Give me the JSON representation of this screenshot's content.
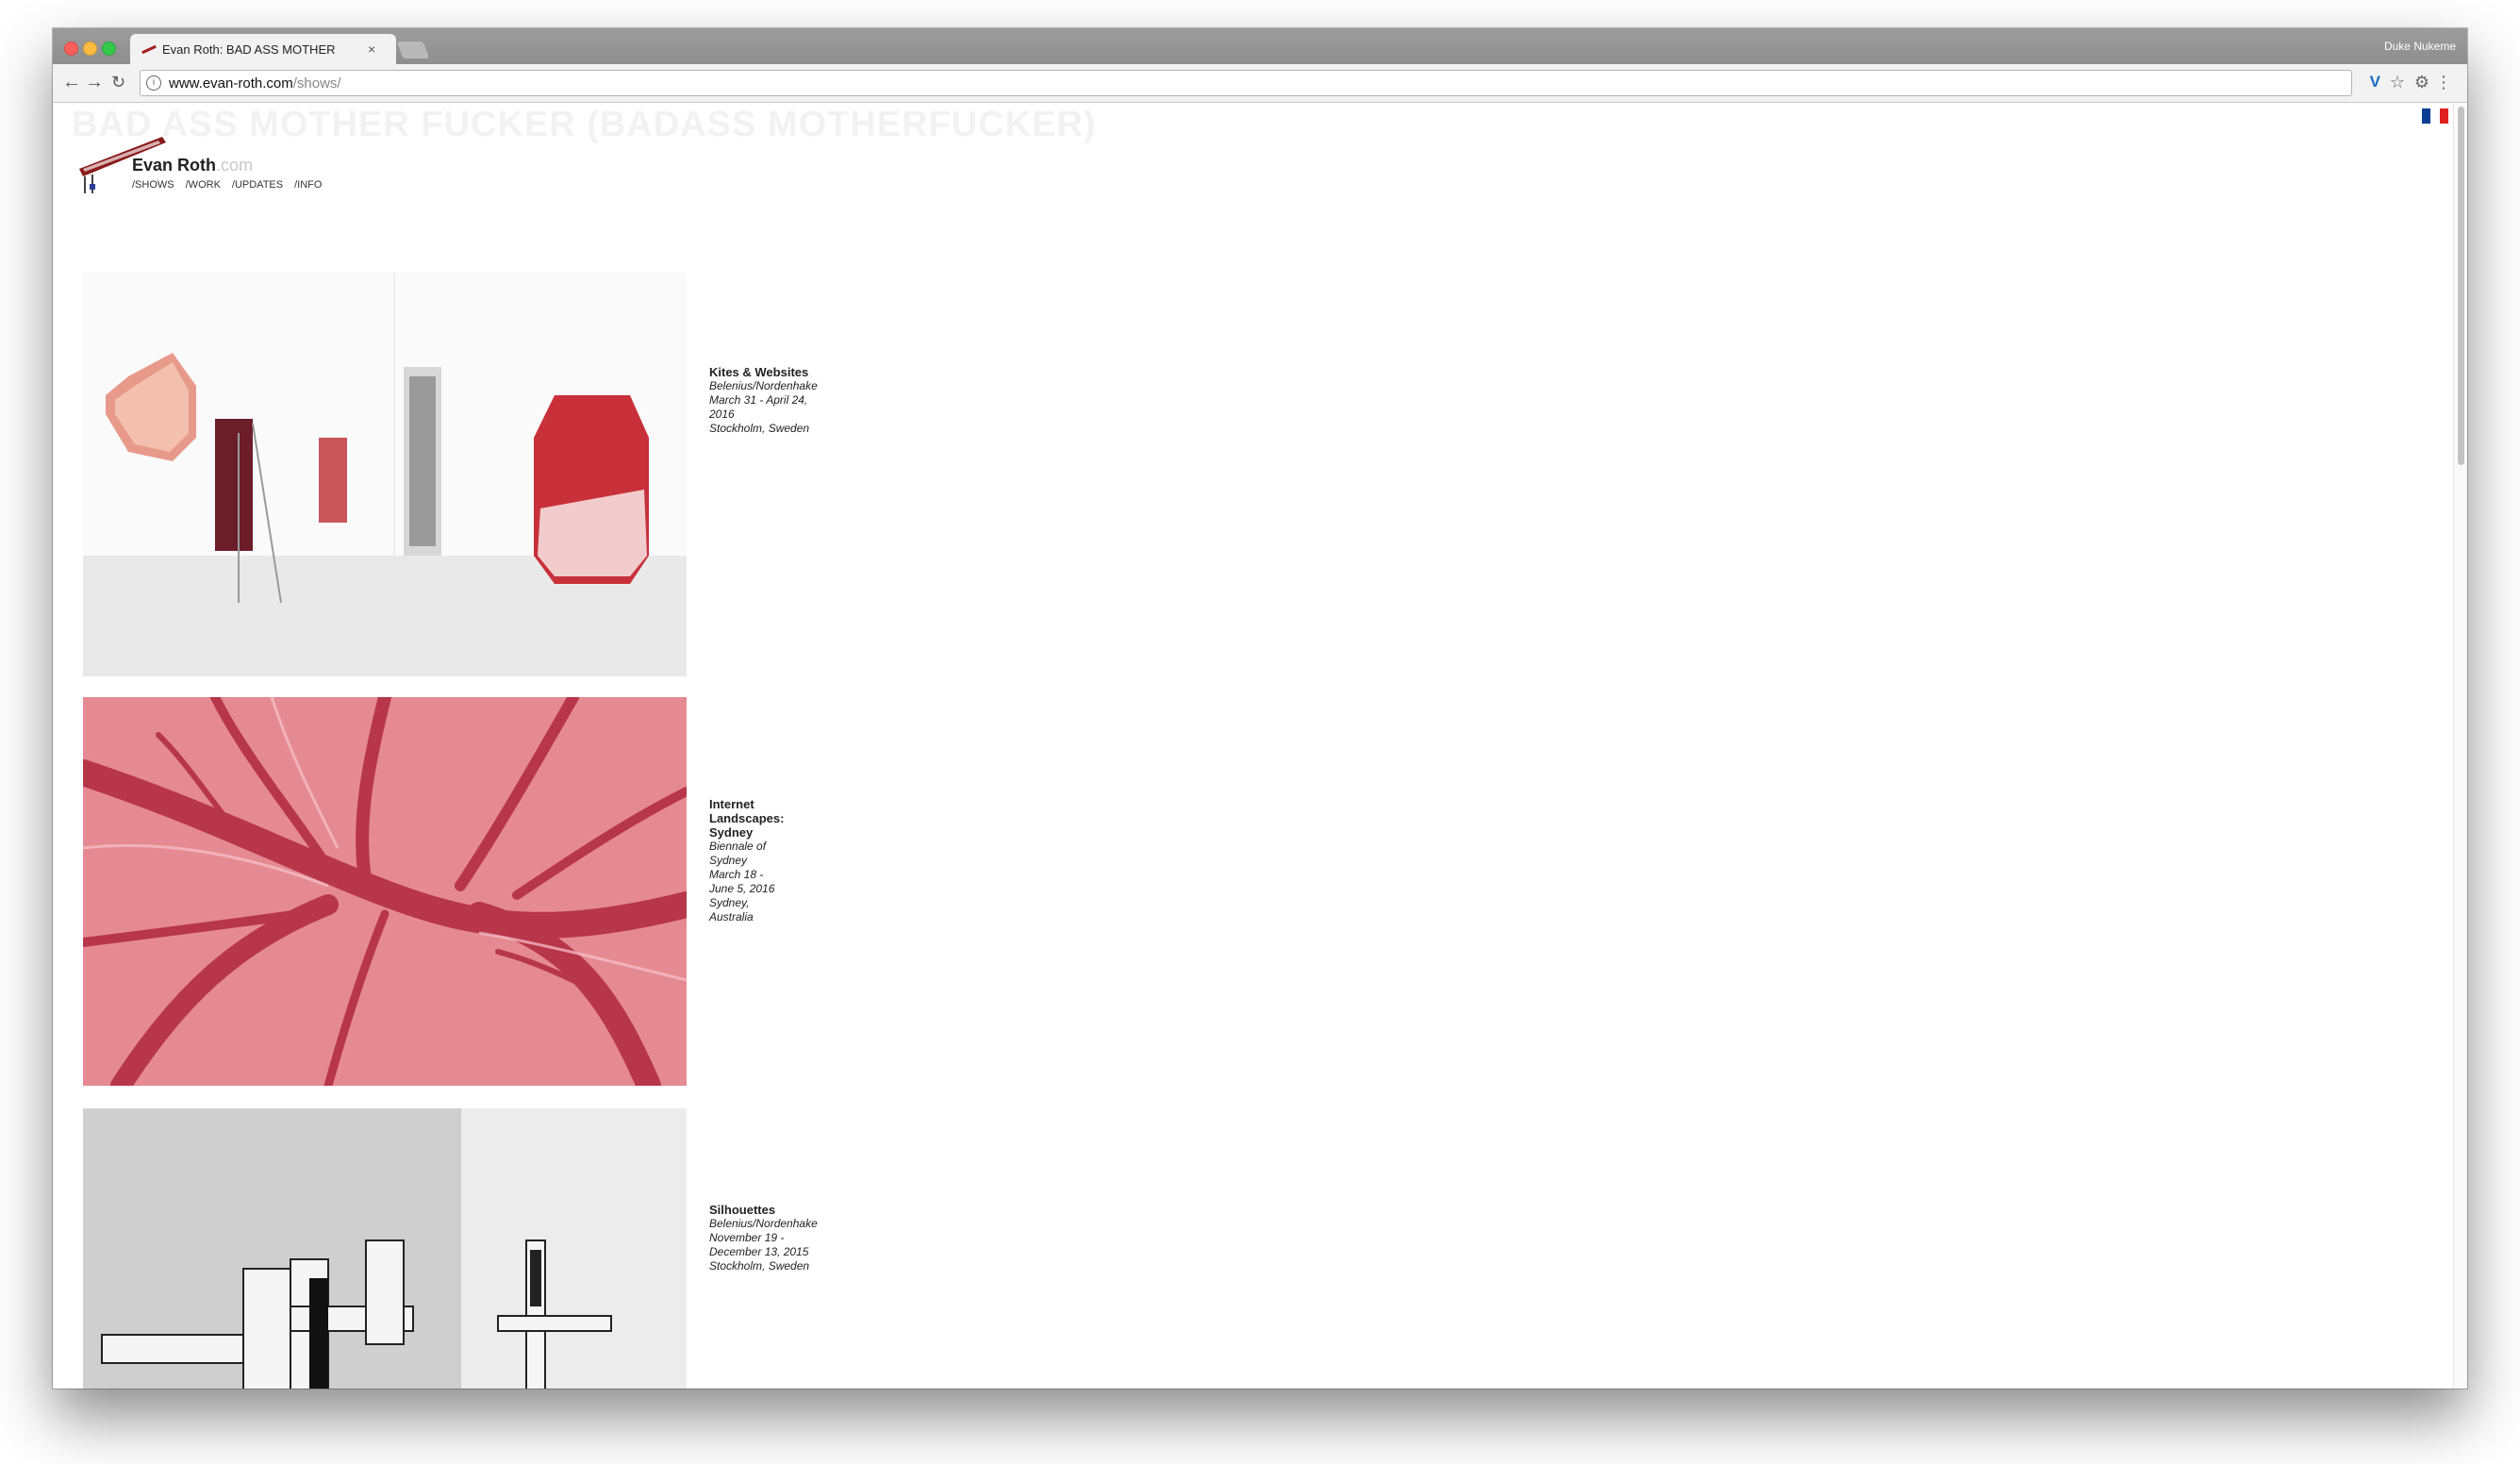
{
  "browser": {
    "tab_title": "Evan Roth: BAD ASS MOTHER",
    "tab_close": "×",
    "profile_name": "Duke Nukeme",
    "url_host": "www.evan-roth.com",
    "url_path": "/shows/"
  },
  "site": {
    "ghost_heading": "BAD ASS MOTHER FUCKER (BADASS MOTHERFUCKER)",
    "logo_name": "Evan Roth",
    "logo_suffix": ".com",
    "nav": [
      "/SHOWS",
      "/WORK",
      "/UPDATES",
      "/INFO"
    ],
    "flag_colors": [
      "#0a3d91",
      "#ffffff",
      "#e02020"
    ]
  },
  "shows": [
    {
      "title": "Kites & Websites",
      "venue": "Belenius/Nordenhake",
      "dates": "March 31 - April 24, 2016",
      "location": "Stockholm, Sweden"
    },
    {
      "title": "Internet Landscapes: Sydney",
      "venue": "Biennale of Sydney",
      "dates": "March 18 - June 5, 2016",
      "location": "Sydney, Australia"
    },
    {
      "title": "Silhouettes",
      "venue": "Belenius/Nordenhake",
      "dates": "November 19 - December 13, 2015",
      "location": "Stockholm, Sweden"
    }
  ]
}
